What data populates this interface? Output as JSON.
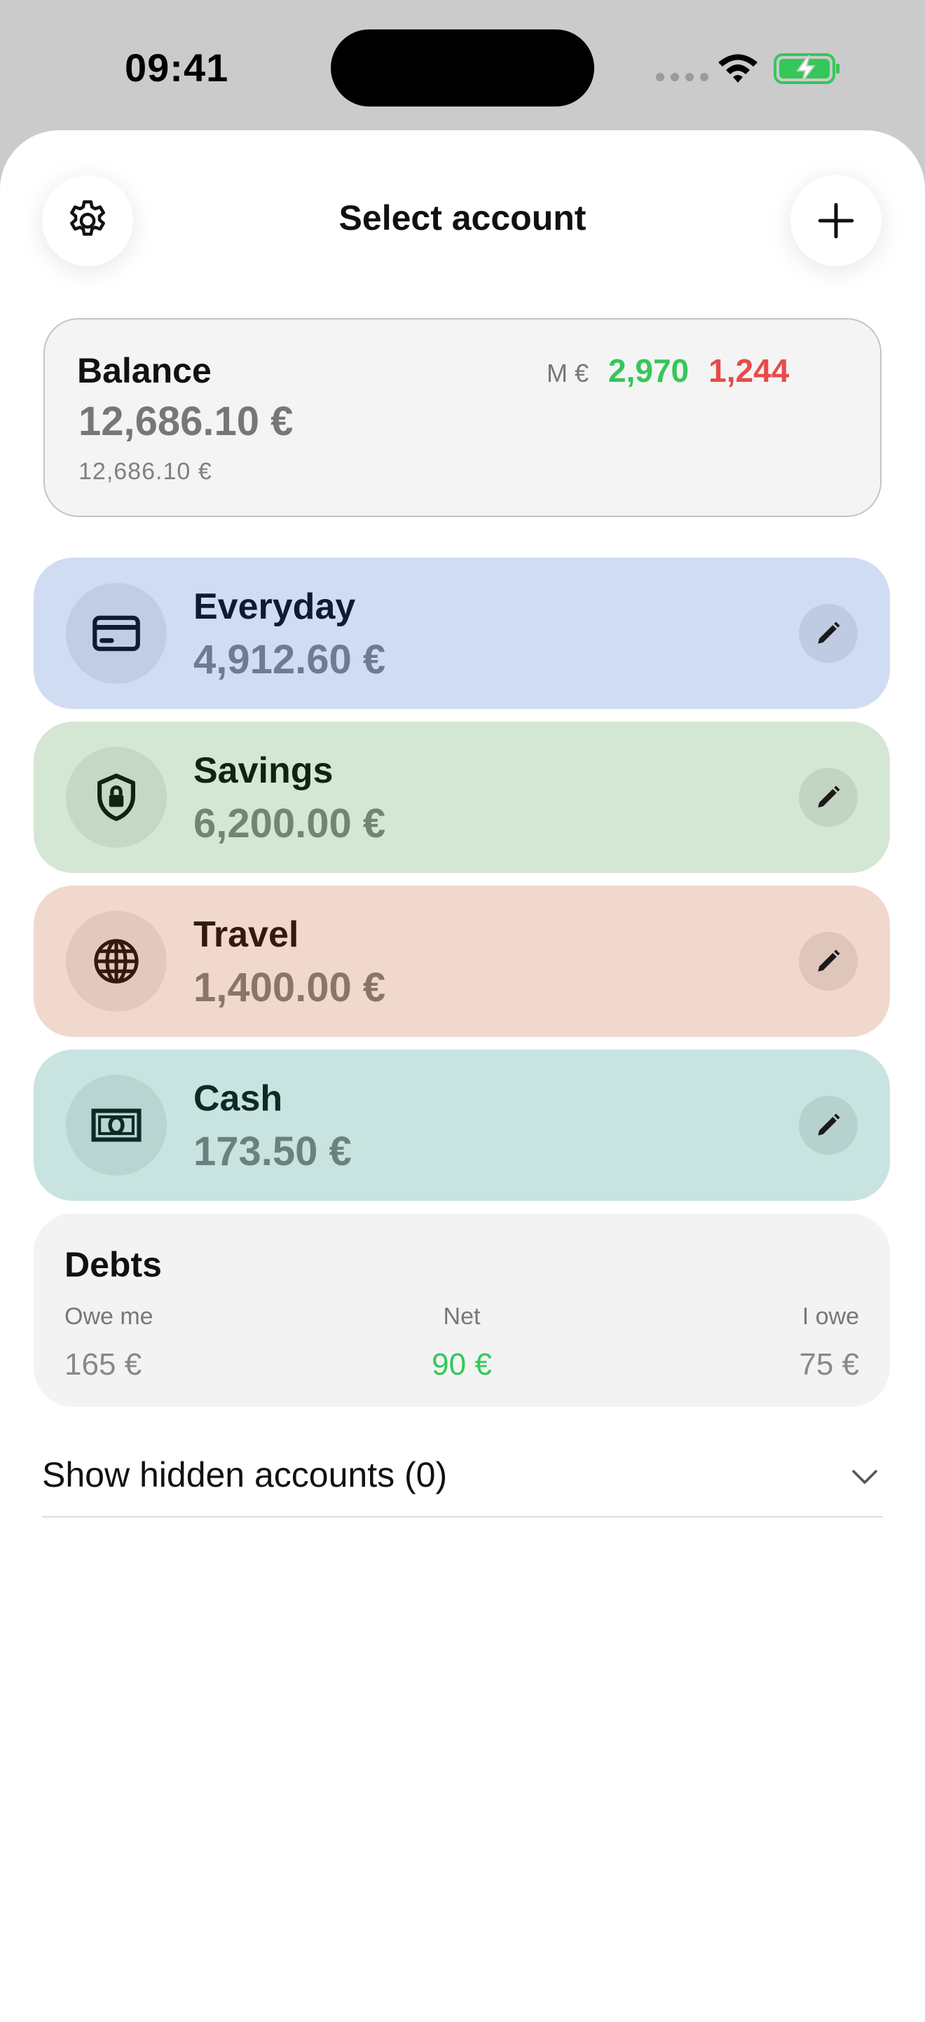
{
  "status_bar": {
    "time": "09:41"
  },
  "header": {
    "title": "Select account",
    "settings_icon": "gear-icon",
    "add_icon": "plus-icon"
  },
  "balance": {
    "label": "Balance",
    "amount": "12,686.10 €",
    "secondary_amount": "12,686.10 €",
    "period_unit": "M €",
    "income": "2,970",
    "expense": "1,244",
    "income_color": "#34c759",
    "expense_color": "#e84a4a"
  },
  "accounts": [
    {
      "name": "Everyday",
      "amount": "4,912.60 €",
      "icon": "credit-card-icon",
      "color": "#d0dcf2"
    },
    {
      "name": "Savings",
      "amount": "6,200.00 €",
      "icon": "shield-lock-icon",
      "color": "#d4e6d4"
    },
    {
      "name": "Travel",
      "amount": "1,400.00 €",
      "icon": "globe-icon",
      "color": "#f1d8cd"
    },
    {
      "name": "Cash",
      "amount": "173.50 €",
      "icon": "banknote-icon",
      "color": "#c9e4e0"
    }
  ],
  "debts": {
    "title": "Debts",
    "owe_me_label": "Owe me",
    "owe_me_value": "165 €",
    "net_label": "Net",
    "net_value": "90 €",
    "i_owe_label": "I owe",
    "i_owe_value": "75 €"
  },
  "hidden_accounts": {
    "label": "Show hidden accounts (0)"
  }
}
